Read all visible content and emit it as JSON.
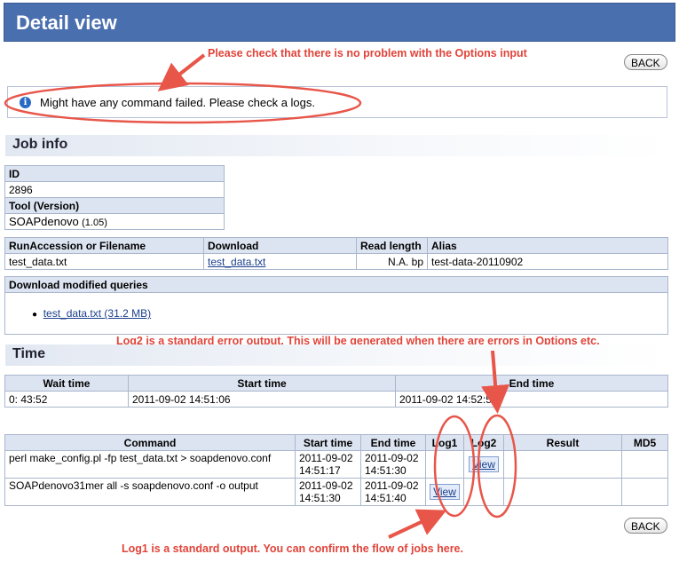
{
  "header": {
    "title": "Detail view"
  },
  "back_label": "BACK",
  "annotations": {
    "options_note": "Please check that there is no problem with the Options input",
    "log2_note": "Log2 is a standard error output. This will be generated when there are errors in Options etc.",
    "log1_note": "Log1 is a standard output. You can confirm the flow of jobs here."
  },
  "notice": {
    "icon": "info-icon",
    "text": "Might have any command failed. Please check a logs."
  },
  "job_info": {
    "heading": "Job info",
    "id_label": "ID",
    "id_value": "2896",
    "tool_label": "Tool (Version)",
    "tool_name": "SOAPdenovo",
    "tool_version": "(1.05)",
    "file_headers": [
      "RunAccession or Filename",
      "Download",
      "Read length",
      "Alias"
    ],
    "file_row": {
      "filename": "test_data.txt",
      "download": "test_data.txt",
      "read_length": "N.A. bp",
      "alias": "test-data-20110902"
    },
    "modified_label": "Download modified queries",
    "modified_link": "test_data.txt (31.2 MB)"
  },
  "time": {
    "heading": "Time",
    "headers": [
      "Wait time",
      "Start time",
      "End time"
    ],
    "values": [
      "0: 43:52",
      "2011-09-02 14:51:06",
      "2011-09-02 14:52:52"
    ]
  },
  "commands": {
    "headers": [
      "Command",
      "Start time",
      "End time",
      "Log1",
      "Log2",
      "Result",
      "MD5"
    ],
    "view_label": "View",
    "rows": [
      {
        "command": "perl make_config.pl -fp test_data.txt > soapdenovo.conf",
        "start_date": "2011-09-02",
        "start_time": "14:51:17",
        "end_date": "2011-09-02",
        "end_time": "14:51:30"
      },
      {
        "command": "SOAPdenovo31mer all -s soapdenovo.conf -o output",
        "start_date": "2011-09-02",
        "start_time": "14:51:30",
        "end_date": "2011-09-02",
        "end_time": "14:51:40"
      }
    ]
  },
  "colors": {
    "header": "#4a6fae",
    "annotation": "#e0443a",
    "table_header": "#dde4f1"
  }
}
